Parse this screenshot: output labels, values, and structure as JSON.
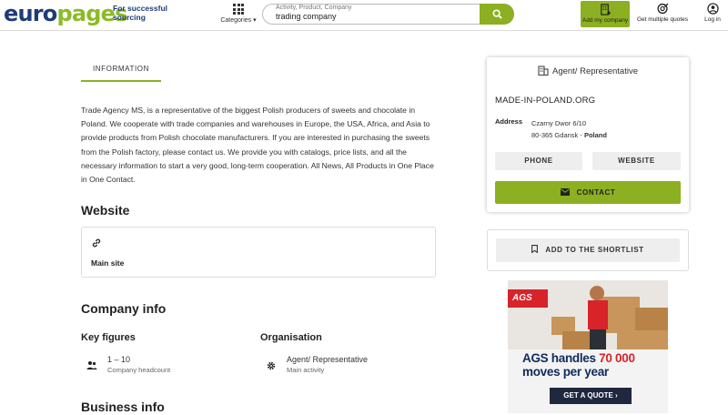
{
  "header": {
    "logo_euro": "euro",
    "logo_pages": "pages",
    "tagline_1": "For successful",
    "tagline_2": "sourcing",
    "categories_label": "Categories",
    "search_placeholder": "Activity, Product, Company",
    "search_value": "trading company",
    "add_company_label": "Add my company",
    "multiple_quotes_label": "Get multiple quotes",
    "login_label": "Log in",
    "accent_color": "#8cb021"
  },
  "main": {
    "tab_information": "INFORMATION",
    "description": "Trade Agency MS, is a representative of the biggest Polish producers of sweets and chocolate in Poland. We cooperate with trade companies and warehouses in Europe, the USA, Africa, and Asia to provide products from Polish chocolate manufacturers. If you are interested in purchasing the sweets from the Polish factory, please contact us. We provide you with catalogs, price lists, and all the necessary information to start a very good, long-term cooperation. All News, All Products in One Place in One Contact.",
    "website_heading": "Website",
    "main_site_label": "Main site",
    "company_info_heading": "Company info",
    "key_figures_heading": "Key figures",
    "headcount_value": "1 – 10",
    "headcount_label": "Company headcount",
    "organisation_heading": "Organisation",
    "main_activity_value": "Agent/ Representative",
    "main_activity_label": "Main activity",
    "business_info_heading": "Business info"
  },
  "card": {
    "company_type": "Agent/ Representative",
    "company_name": "MADE-IN-POLAND.ORG",
    "address_label": "Address",
    "address_line1": "Czarny Dwor 6/10",
    "address_line2": "80-365 Gdansk - ",
    "address_country": "Poland",
    "phone_label": "PHONE",
    "website_label": "WEBSITE",
    "contact_label": "CONTACT"
  },
  "shortlist_label": "ADD TO THE SHORTLIST",
  "ad": {
    "brand": "AGS",
    "headline_1": "AGS handles ",
    "headline_num": "70 000",
    "headline_2": "moves per year",
    "cta": "GET A QUOTE ›"
  }
}
